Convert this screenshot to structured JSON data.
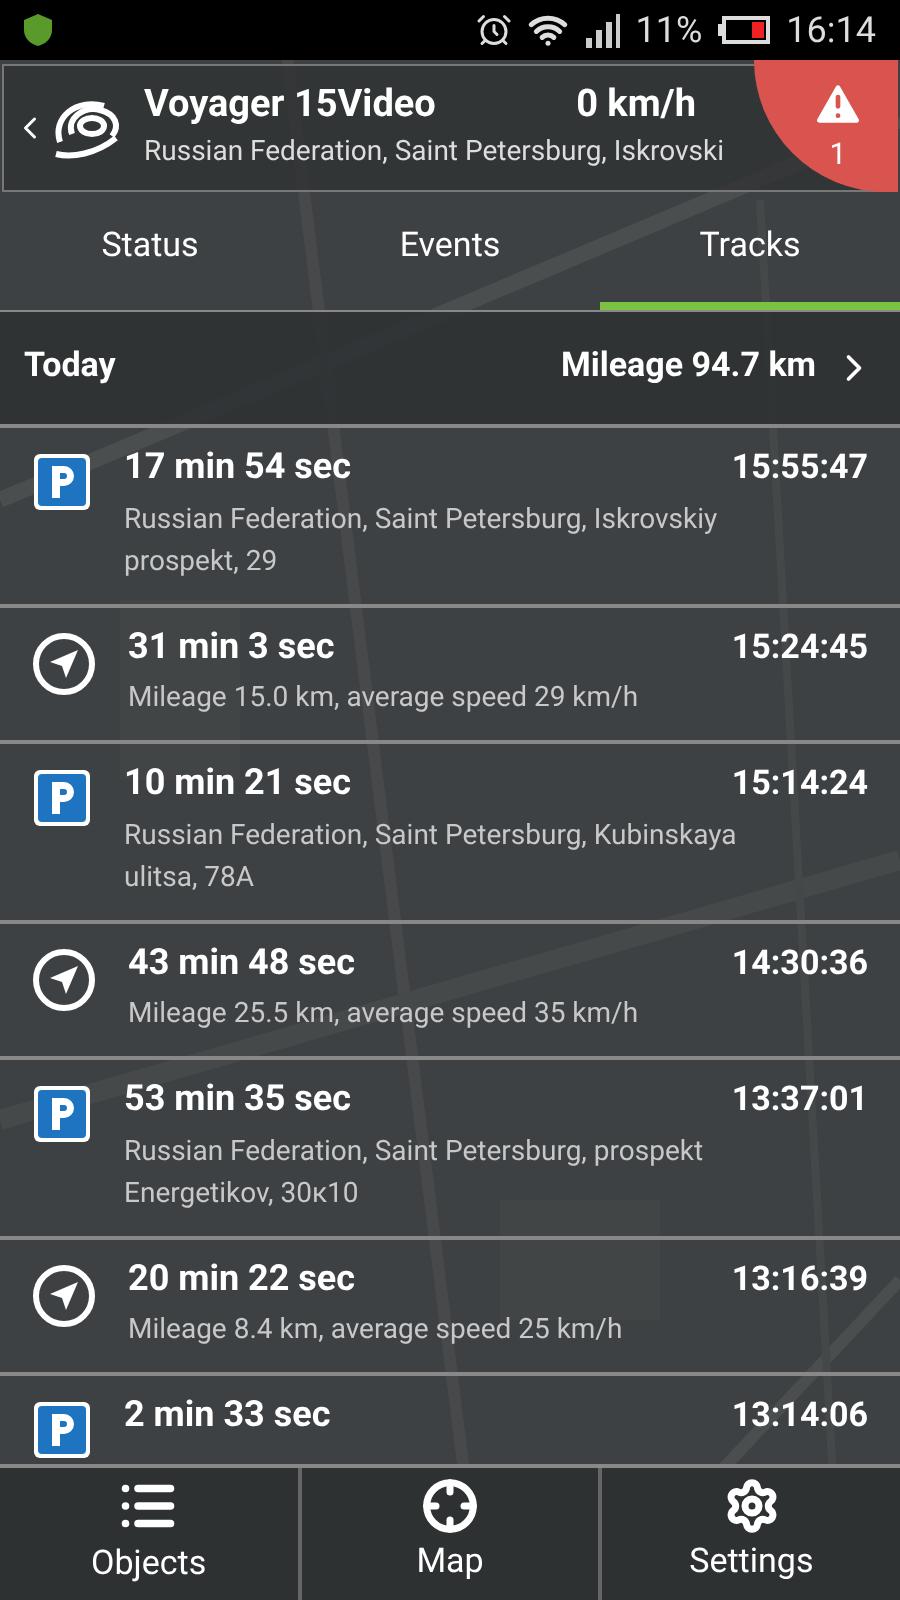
{
  "status_bar": {
    "battery": "11%",
    "time": "16:14"
  },
  "header": {
    "title": "Voyager 15Video",
    "speed": "0 km/h",
    "address": "Russian Federation, Saint Petersburg, Iskrovski",
    "alerts": "1"
  },
  "tabs": [
    {
      "label": "Status",
      "selected": false
    },
    {
      "label": "Events",
      "selected": false
    },
    {
      "label": "Tracks",
      "selected": true
    }
  ],
  "day": {
    "label": "Today",
    "mileage": "Mileage 94.7 km"
  },
  "tracks": [
    {
      "kind": "parking",
      "duration": "17 min 54 sec",
      "time": "15:55:47",
      "detail": "Russian Federation, Saint Petersburg, Iskrovskiy prospekt, 29"
    },
    {
      "kind": "trip",
      "duration": "31 min 3 sec",
      "time": "15:24:45",
      "detail": "Mileage 15.0 km, average speed 29 km/h"
    },
    {
      "kind": "parking",
      "duration": "10 min 21 sec",
      "time": "15:14:24",
      "detail": "Russian Federation, Saint Petersburg, Kubinskaya ulitsa, 78A"
    },
    {
      "kind": "trip",
      "duration": "43 min 48 sec",
      "time": "14:30:36",
      "detail": "Mileage 25.5 km, average speed 35 km/h"
    },
    {
      "kind": "parking",
      "duration": "53 min 35 sec",
      "time": "13:37:01",
      "detail": "Russian Federation, Saint Petersburg, prospekt Energetikov, 30к10"
    },
    {
      "kind": "trip",
      "duration": "20 min 22 sec",
      "time": "13:16:39",
      "detail": "Mileage 8.4 km, average speed 25 km/h"
    },
    {
      "kind": "parking",
      "duration": "2 min 33 sec",
      "time": "13:14:06"
    }
  ],
  "bottom_nav": [
    {
      "kind": "list",
      "label": "Objects"
    },
    {
      "kind": "map",
      "label": "Map"
    },
    {
      "kind": "settings",
      "label": "Settings"
    }
  ]
}
